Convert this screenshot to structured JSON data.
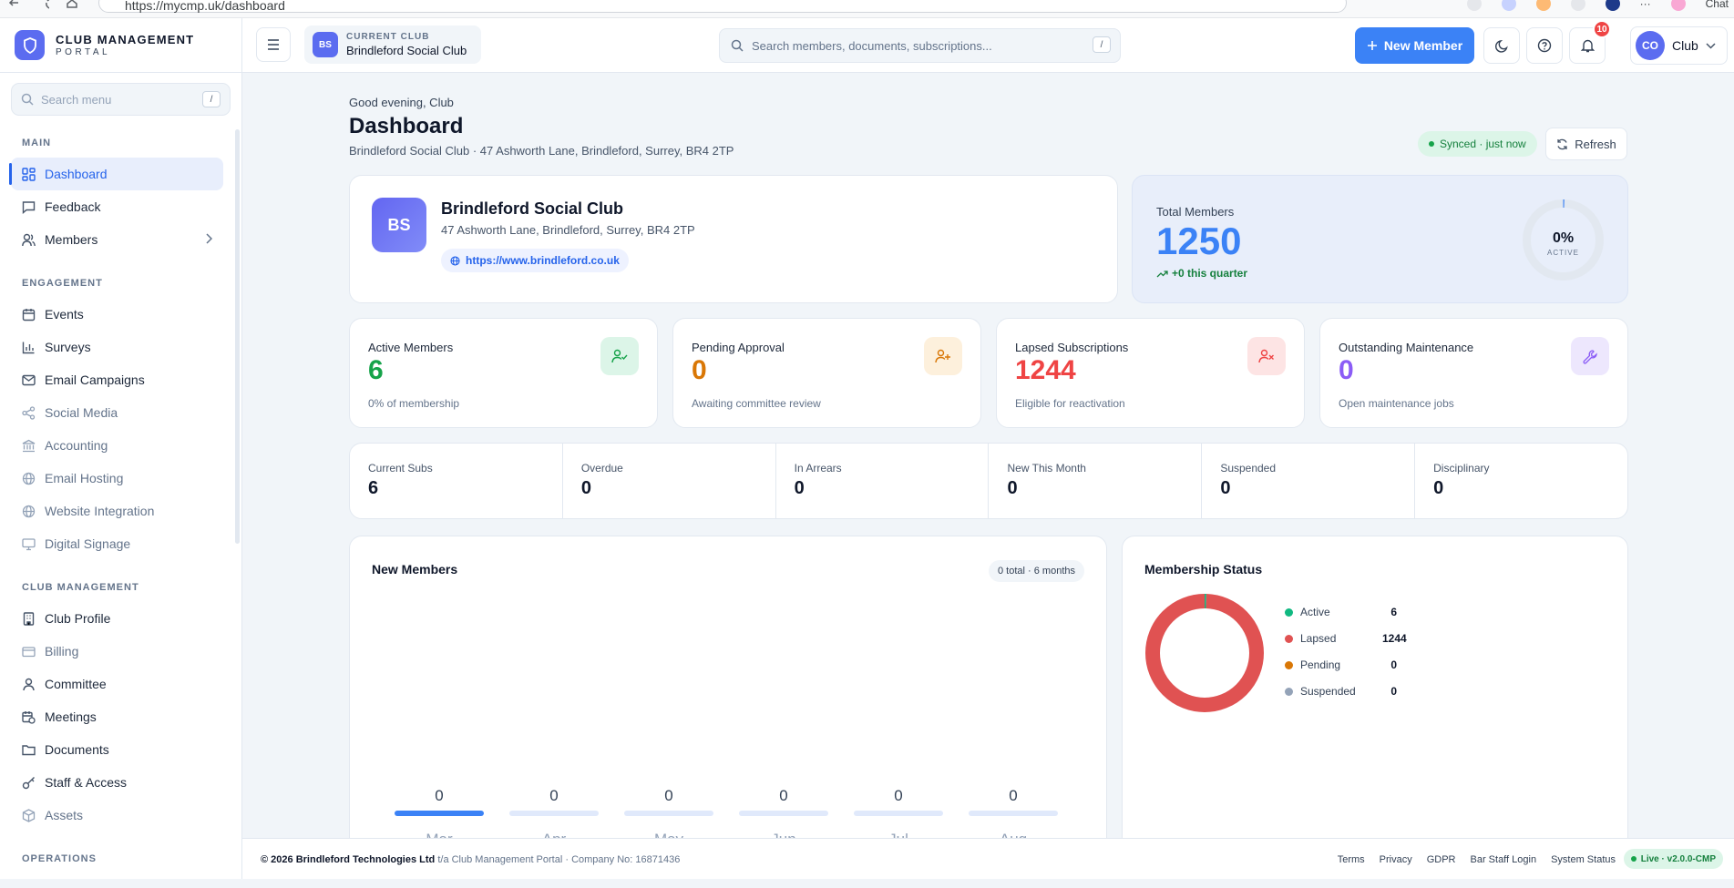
{
  "browser": {
    "url": "https://mycmp.uk/dashboard",
    "ext_label": "Chat"
  },
  "brand": {
    "line1": "CLUB MANAGEMENT",
    "line2": "PORTAL"
  },
  "sidebar": {
    "search_placeholder": "Search menu",
    "search_key": "/",
    "sections": {
      "main": "MAIN",
      "engagement": "ENGAGEMENT",
      "club_management": "CLUB MANAGEMENT",
      "operations": "OPERATIONS"
    },
    "items": {
      "dashboard": "Dashboard",
      "feedback": "Feedback",
      "members": "Members",
      "events": "Events",
      "surveys": "Surveys",
      "email_campaigns": "Email Campaigns",
      "social_media": "Social Media",
      "accounting": "Accounting",
      "email_hosting": "Email Hosting",
      "website_integration": "Website Integration",
      "digital_signage": "Digital Signage",
      "club_profile": "Club Profile",
      "billing": "Billing",
      "committee": "Committee",
      "meetings": "Meetings",
      "documents": "Documents",
      "staff_access": "Staff & Access",
      "assets": "Assets"
    }
  },
  "header": {
    "current_club_label": "CURRENT CLUB",
    "current_club_name": "Brindleford Social Club",
    "club_initials": "BS",
    "search_placeholder": "Search members, documents, subscriptions...",
    "search_key": "/",
    "new_member_label": "New Member",
    "notifications_count": "10",
    "user_initials": "CO",
    "user_name": "Club"
  },
  "page": {
    "greeting": "Good evening, Club",
    "title": "Dashboard",
    "subtitle": "Brindleford Social Club · 47 Ashworth Lane, Brindleford, Surrey, BR4 2TP",
    "synced": "Synced · just now",
    "refresh": "Refresh"
  },
  "club_card": {
    "initials": "BS",
    "name": "Brindleford Social Club",
    "address": "47 Ashworth Lane, Brindleford, Surrey, BR4 2TP",
    "url": "https://www.brindleford.co.uk"
  },
  "total_members": {
    "label": "Total Members",
    "value": "1250",
    "delta": "+0 this quarter",
    "active_pct": "0%",
    "active_label": "ACTIVE",
    "active_fraction": 0.0048
  },
  "stats": {
    "active": {
      "label": "Active Members",
      "value": "6",
      "note": "0% of membership",
      "color": "#16a34a"
    },
    "pending": {
      "label": "Pending Approval",
      "value": "0",
      "note": "Awaiting committee review",
      "color": "#d97706"
    },
    "lapsed": {
      "label": "Lapsed Subscriptions",
      "value": "1244",
      "note": "Eligible for reactivation",
      "color": "#ef4444"
    },
    "maintenance": {
      "label": "Outstanding Maintenance",
      "value": "0",
      "note": "Open maintenance jobs",
      "color": "#8b5cf6"
    }
  },
  "mini_stats": [
    {
      "label": "Current Subs",
      "value": "6"
    },
    {
      "label": "Overdue",
      "value": "0"
    },
    {
      "label": "In Arrears",
      "value": "0"
    },
    {
      "label": "New This Month",
      "value": "0"
    },
    {
      "label": "Suspended",
      "value": "0"
    },
    {
      "label": "Disciplinary",
      "value": "0"
    }
  ],
  "new_members": {
    "title": "New Members",
    "pill": "0 total · 6 months"
  },
  "membership_status": {
    "title": "Membership Status"
  },
  "chart_data": [
    {
      "type": "bar",
      "title": "New Members",
      "categories": [
        "Mar",
        "Apr",
        "May",
        "Jun",
        "Jul",
        "Aug"
      ],
      "values": [
        0,
        0,
        0,
        0,
        0,
        0
      ],
      "data_labels": [
        "0",
        "0",
        "0",
        "0",
        "0",
        "0"
      ],
      "colors": {
        "highlight": "#3b82f6",
        "track": "#e0e9fb"
      }
    },
    {
      "type": "pie",
      "title": "Membership Status",
      "labels": [
        "Active",
        "Lapsed",
        "Pending",
        "Suspended"
      ],
      "values": [
        6,
        1244,
        0,
        0
      ],
      "value_labels": [
        "6",
        "1244",
        "0",
        "0"
      ],
      "colors": [
        "#10b981",
        "#e05252",
        "#d97706",
        "#94a3b8"
      ],
      "style": "donut"
    }
  ],
  "footer": {
    "company": "© 2026 Brindleford Technologies Ltd",
    "company_suffix": "t/a Club Management Portal · Company No: 16871436",
    "links": [
      "Terms",
      "Privacy",
      "GDPR",
      "Bar Staff Login",
      "System Status"
    ],
    "live": "Live · v2.0.0-CMP"
  },
  "colors": {
    "accent": "#3b82f6",
    "brand": "#5b6cf0",
    "success": "#16a34a",
    "danger": "#ef4444"
  }
}
